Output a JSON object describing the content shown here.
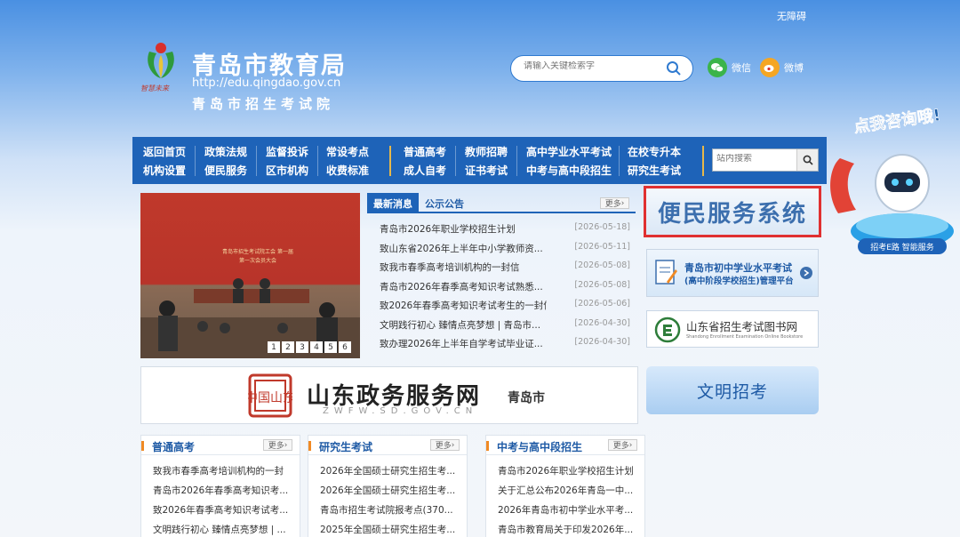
{
  "header": {
    "accessibility": "无障碍",
    "title": "青岛市教育局",
    "url": "http://edu.qingdao.gov.cn",
    "subtitle": "青岛市招生考试院",
    "logo_motto": "智慧未来",
    "search_placeholder": "请输入关键检索字",
    "wechat": "微信",
    "weibo": "微博",
    "promo": "点我咨询哦!",
    "promo_badge": "招考E路 智能服务"
  },
  "nav": {
    "columns": [
      [
        "返回首页",
        "机构设置"
      ],
      [
        "政策法规",
        "便民服务"
      ],
      [
        "监督投诉",
        "区市机构"
      ],
      [
        "常设考点",
        "收费标准"
      ],
      [
        "普通高考",
        "成人自考"
      ],
      [
        "教师招聘",
        "证书考试"
      ],
      [
        "高中学业水平考试",
        "中考与高中段招生"
      ],
      [
        "在校专升本",
        "研究生考试"
      ]
    ],
    "search_placeholder": "站内搜索"
  },
  "carousel": {
    "banner_text": "青岛市招生考试院工会 第一届第一次会员大会",
    "pages": [
      "1",
      "2",
      "3",
      "4",
      "5",
      "6"
    ]
  },
  "news": {
    "tabs": [
      "最新消息",
      "公示公告"
    ],
    "more": "更多",
    "items": [
      {
        "title": "青岛市2026年职业学校招生计划",
        "date": "[2026-05-18]"
      },
      {
        "title": "致山东省2026年上半年中小学教师资...",
        "date": "[2026-05-11]"
      },
      {
        "title": "致我市春季高考培训机构的一封信",
        "date": "[2026-05-08]"
      },
      {
        "title": "青岛市2026年春季高考知识考试熟悉...",
        "date": "[2026-05-08]"
      },
      {
        "title": "致2026年春季高考知识考试考生的一封信",
        "date": "[2026-05-06]"
      },
      {
        "title": "文明践行初心 臻情点亮梦想 | 青岛市...",
        "date": "[2026-04-30]"
      },
      {
        "title": "致办理2026年上半年自学考试毕业证...",
        "date": "[2026-04-30]"
      }
    ]
  },
  "side": {
    "bianmin": "便民服务系统",
    "xueye_title": "青岛市初中学业水平考试",
    "xueye_sub": "(高中阶段学校招生)管理平台",
    "library_title": "山东省招生考试图书网",
    "library_sub": "Shandong Enrollment Examination Online Bookstore",
    "wenming": "文明招考"
  },
  "zwfw": {
    "title": "山东政务服务网",
    "domain": "ZWFW.SD.GOV.CN",
    "city": "青岛市",
    "seal": "中国山东"
  },
  "columns": [
    {
      "title": "普通高考",
      "more": "更多",
      "items": [
        "致我市春季高考培训机构的一封",
        "青岛市2026年春季高考知识考...",
        "致2026年春季高考知识考试考...",
        "文明践行初心 臻情点亮梦想 | ..."
      ]
    },
    {
      "title": "研究生考试",
      "more": "更多",
      "items": [
        "2026年全国硕士研究生招生考...",
        "2026年全国硕士研究生招生考...",
        "青岛市招生考试院报考点(370...",
        "2025年全国硕士研究生招生考..."
      ]
    },
    {
      "title": "中考与高中段招生",
      "more": "更多",
      "items": [
        "青岛市2026年职业学校招生计划",
        "关于汇总公布2026年青岛一中...",
        "2026年青岛市初中学业水平考...",
        "青岛市教育局关于印发2026年..."
      ]
    }
  ]
}
